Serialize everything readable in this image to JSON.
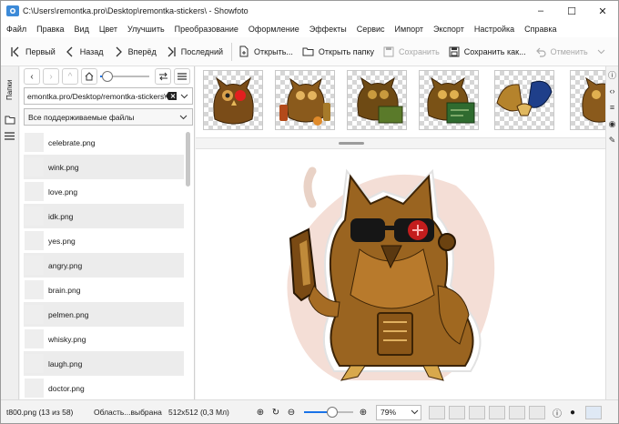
{
  "window": {
    "title": "C:\\Users\\remontka.pro\\Desktop\\remontka-stickers\\ - Showfoto",
    "minimize": "–",
    "maximize": "☐",
    "close": "✕"
  },
  "menu": [
    "Файл",
    "Правка",
    "Вид",
    "Цвет",
    "Улучшить",
    "Преобразование",
    "Оформление",
    "Эффекты",
    "Сервис",
    "Импорт",
    "Экспорт",
    "Настройка",
    "Справка"
  ],
  "toolbar": {
    "first": "Первый",
    "back": "Назад",
    "forward": "Вперёд",
    "last": "Последний",
    "open": "Открыть...",
    "open_folder": "Открыть папку",
    "save": "Сохранить",
    "save_as": "Сохранить как...",
    "undo": "Отменить"
  },
  "sidebar": {
    "tab_label": "Папки"
  },
  "folder": {
    "path": "emontka.pro/Desktop/remontka-stickers\\",
    "filter": "Все поддерживаемые файлы"
  },
  "files": [
    "celebrate.png",
    "wink.png",
    "love.png",
    "idk.png",
    "yes.png",
    "angry.png",
    "brain.png",
    "pelmen.png",
    "whisky.png",
    "laugh.png",
    "doctor.png"
  ],
  "thumbnails": [
    "owl-red-eye",
    "owl-bottles",
    "owl-laptop",
    "owl-board",
    "wings-handshake",
    "owl-partial"
  ],
  "status": {
    "file": "t800.png (13 из 58)",
    "selection": "Область...выбрана",
    "size": "512x512 (0,3 Мл)",
    "zoom": "79%"
  },
  "colors": {
    "accent": "#1a73e8",
    "bronze": "#8a5a1c",
    "red_eye": "#e21f1f"
  }
}
